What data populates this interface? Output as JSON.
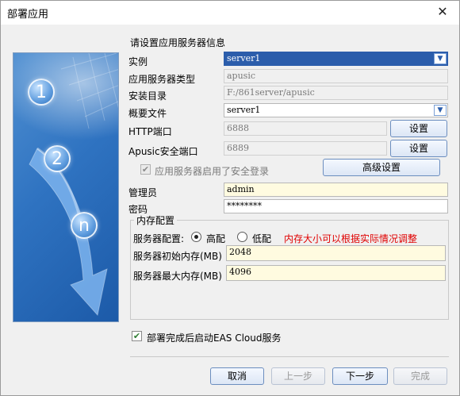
{
  "window": {
    "title": "部署应用",
    "close_glyph": "✕"
  },
  "heading": "请设置应用服务器信息",
  "art": {
    "steps": [
      "1",
      "2",
      "n"
    ]
  },
  "form": {
    "instance": {
      "label": "实例",
      "value": "server1"
    },
    "server_type": {
      "label": "应用服务器类型",
      "value": "apusic"
    },
    "install_dir": {
      "label": "安装目录",
      "value": "F:/861server/apusic"
    },
    "profile": {
      "label": "概要文件",
      "value": "server1"
    },
    "http_port": {
      "label": "HTTP端口",
      "value": "6888",
      "button": "设置"
    },
    "secure_port": {
      "label": "Apusic安全端口",
      "value": "6889",
      "button": "设置"
    },
    "secure_login": {
      "label": "应用服务器启用了安全登录",
      "checked": true
    },
    "advanced_button": "高级设置",
    "admin": {
      "label": "管理员",
      "value": "admin"
    },
    "password": {
      "label": "密码",
      "value": "********"
    }
  },
  "memory": {
    "group_title": "内存配置",
    "config_label": "服务器配置:",
    "options": [
      {
        "label": "高配",
        "selected": true
      },
      {
        "label": "低配",
        "selected": false
      }
    ],
    "hint": "内存大小可以根据实际情况调整",
    "initial": {
      "label": "服务器初始内存(MB)",
      "value": "2048"
    },
    "max": {
      "label": "服务器最大内存(MB)",
      "value": "4096"
    }
  },
  "start_after_deploy": {
    "label": "部署完成后启动EAS Cloud服务",
    "checked": true
  },
  "footer": {
    "cancel": "取消",
    "prev": "上一步",
    "next": "下一步",
    "finish": "完成"
  },
  "colors": {
    "selection": "#2b5dab",
    "warning": "#e00000",
    "editable_bg": "#fffbe0"
  }
}
